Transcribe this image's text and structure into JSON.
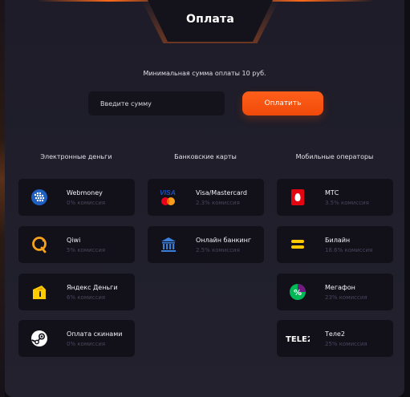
{
  "colors": {
    "accent": "#ff5f1a",
    "card_bg": "#12111a",
    "panel_bg": "#1f1e2a"
  },
  "header": {
    "title": "Оплата"
  },
  "payment": {
    "min_text": "Минимальная сумма оплаты 10 руб.",
    "input_placeholder": "Введите сумму",
    "pay_label": "Оплатить"
  },
  "columns": [
    {
      "title": "Электронные деньги",
      "methods": [
        {
          "name": "Webmoney",
          "fee": "0% комиссия",
          "icon": "webmoney-icon"
        },
        {
          "name": "Qiwi",
          "fee": "5% комиссия",
          "icon": "qiwi-icon"
        },
        {
          "name": "Яндекс Деньги",
          "fee": "6% комиссия",
          "icon": "yandex-money-icon"
        },
        {
          "name": "Оплата скинами",
          "fee": "0% комиссия",
          "icon": "steam-icon"
        }
      ]
    },
    {
      "title": "Банковские карты",
      "methods": [
        {
          "name": "Visa/Mastercard",
          "fee": "2.3% комиссия",
          "icon": "visa-mastercard-icon"
        },
        {
          "name": "Онлайн банкинг",
          "fee": "2.5% комиссия",
          "icon": "bank-icon"
        }
      ]
    },
    {
      "title": "Мобильные операторы",
      "methods": [
        {
          "name": "МТС",
          "fee": "3.5% комиссия",
          "icon": "mts-icon"
        },
        {
          "name": "Билайн",
          "fee": "18.6% комиссия",
          "icon": "beeline-icon"
        },
        {
          "name": "Мегафон",
          "fee": "23% комиссия",
          "icon": "megafon-icon"
        },
        {
          "name": "Теле2",
          "fee": "25% комиссия",
          "icon": "tele2-icon"
        }
      ]
    }
  ]
}
